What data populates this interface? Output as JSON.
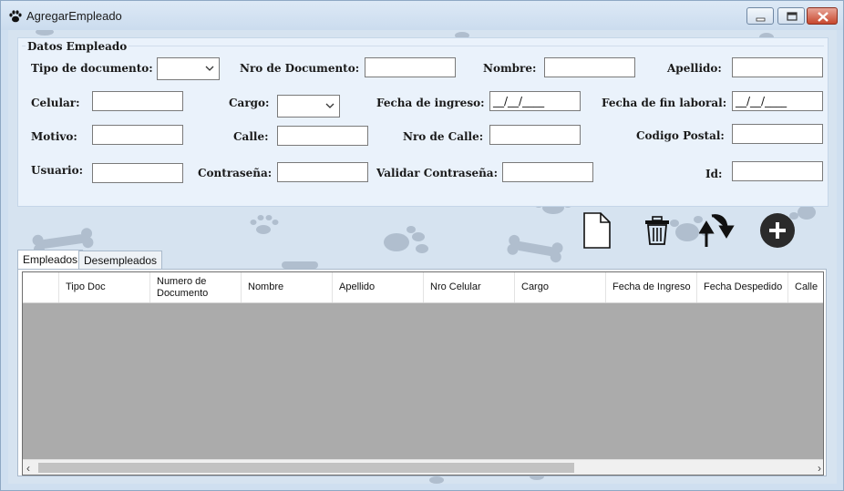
{
  "window": {
    "title": "AgregarEmpleado"
  },
  "group": {
    "legend": "Datos Empleado",
    "labels": {
      "tipo_documento": "Tipo de documento:",
      "nro_documento": "Nro de Documento:",
      "nombre": "Nombre:",
      "apellido": "Apellido:",
      "celular": "Celular:",
      "cargo": "Cargo:",
      "fecha_ingreso": "Fecha de ingreso:",
      "fecha_fin": "Fecha de fin laboral:",
      "motivo": "Motivo:",
      "calle": "Calle:",
      "nro_calle": "Nro de Calle:",
      "codigo_postal": "Codigo Postal:",
      "usuario": "Usuario:",
      "contrasena": "Contraseña:",
      "validar_contrasena": "Validar Contraseña:",
      "id": "Id:"
    },
    "values": {
      "fecha_ingreso": "__/__/____",
      "fecha_fin": "__/__/____"
    }
  },
  "toolbar": {
    "icons": [
      "new-document-icon",
      "trash-icon",
      "refresh-icon",
      "add-icon"
    ]
  },
  "tabs": [
    "Empleados",
    "Desempleados"
  ],
  "grid": {
    "columns": [
      "",
      "Tipo Doc",
      "Numero de Documento",
      "Nombre",
      "Apellido",
      "Nro Celular",
      "Cargo",
      "Fecha de Ingreso",
      "Fecha Despedido",
      "Calle"
    ]
  },
  "colors": {
    "accent": "#2b2b2b",
    "grid_bg": "#ababab",
    "window_bg": "#cfdff0"
  }
}
